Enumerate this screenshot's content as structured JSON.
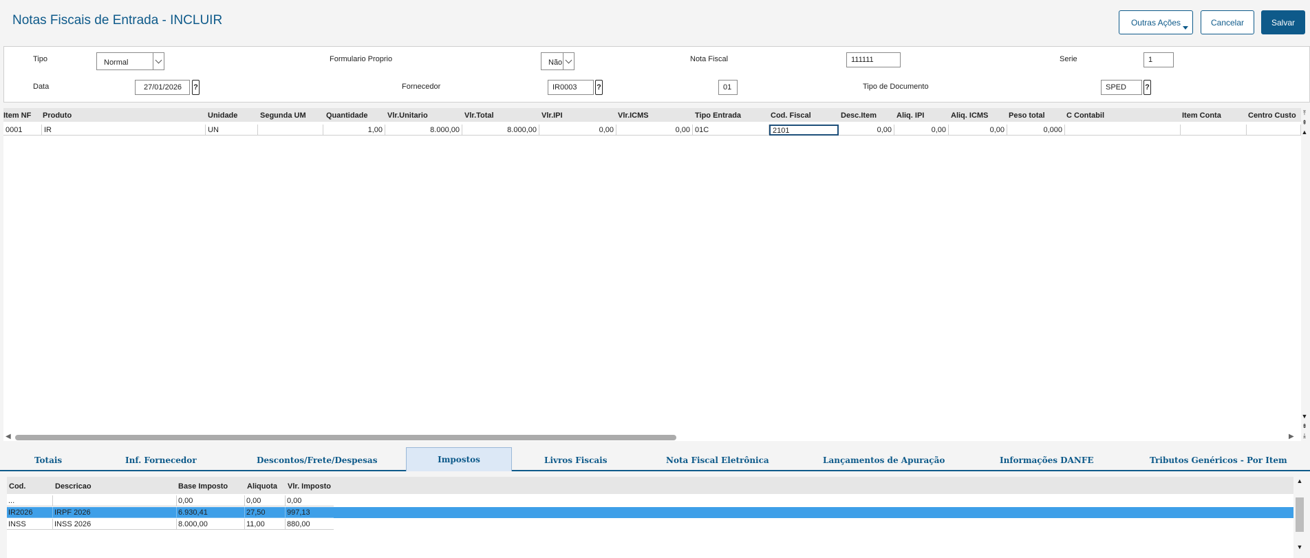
{
  "header": {
    "title": "Notas Fiscais de Entrada - INCLUIR",
    "outras_acoes": "Outras Ações",
    "cancelar": "Cancelar",
    "salvar": "Salvar"
  },
  "form": {
    "tipo_label": "Tipo",
    "tipo_value": "Normal",
    "formulario_label": "Formulario Proprio",
    "formulario_value": "Não",
    "nota_label": "Nota Fiscal",
    "nota_value": "111111",
    "serie_label": "Serie",
    "serie_value": "1",
    "data_label": "Data",
    "data_value": "27/01/2026",
    "fornecedor_label": "Fornecedor",
    "fornecedor_value": "IR0003",
    "loja_value": "01",
    "tipodoc_label": "Tipo de Documento",
    "tipodoc_value": "SPED",
    "help": "?"
  },
  "items": {
    "columns": [
      "Item NF",
      "Produto",
      "Unidade",
      "Segunda UM",
      "Quantidade",
      "Vlr.Unitario",
      "Vlr.Total",
      "Vlr.IPI",
      "Vlr.ICMS",
      "Tipo Entrada",
      "Cod. Fiscal",
      "Desc.Item",
      "Aliq. IPI",
      "Aliq. ICMS",
      "Peso total",
      "C Contabil",
      "Item Conta",
      "Centro Custo"
    ],
    "rows": [
      [
        "0001",
        "IR",
        "UN",
        "",
        "1,00",
        "8.000,00",
        "8.000,00",
        "0,00",
        "0,00",
        "01C",
        "2101",
        "0,00",
        "0,00",
        "0,00",
        "0,000",
        "",
        "",
        ""
      ]
    ]
  },
  "tabs": [
    "Totais",
    "Inf. Fornecedor",
    "Descontos/Frete/Despesas",
    "Impostos",
    "Livros Fiscais",
    "Nota Fiscal Eletrônica",
    "Lançamentos de Apuração",
    "Informações DANFE",
    "Tributos Genéricos - Por Item"
  ],
  "taxes": {
    "columns": [
      "Cod.",
      "Descricao",
      "Base Imposto",
      "Aliquota",
      "Vlr. Imposto"
    ],
    "rows": [
      [
        "...",
        "",
        "0,00",
        "0,00",
        "0,00"
      ],
      [
        "IR2026",
        "IRPF 2026",
        "6.930,41",
        "27,50",
        "997,13"
      ],
      [
        "INSS",
        "INSS 2026",
        "8.000,00",
        "11,00",
        "880,00"
      ]
    ]
  },
  "colors": {
    "accent": "#0e5a8a",
    "selected_row": "#3e9fe8",
    "active_tab": "#dce8f6"
  }
}
